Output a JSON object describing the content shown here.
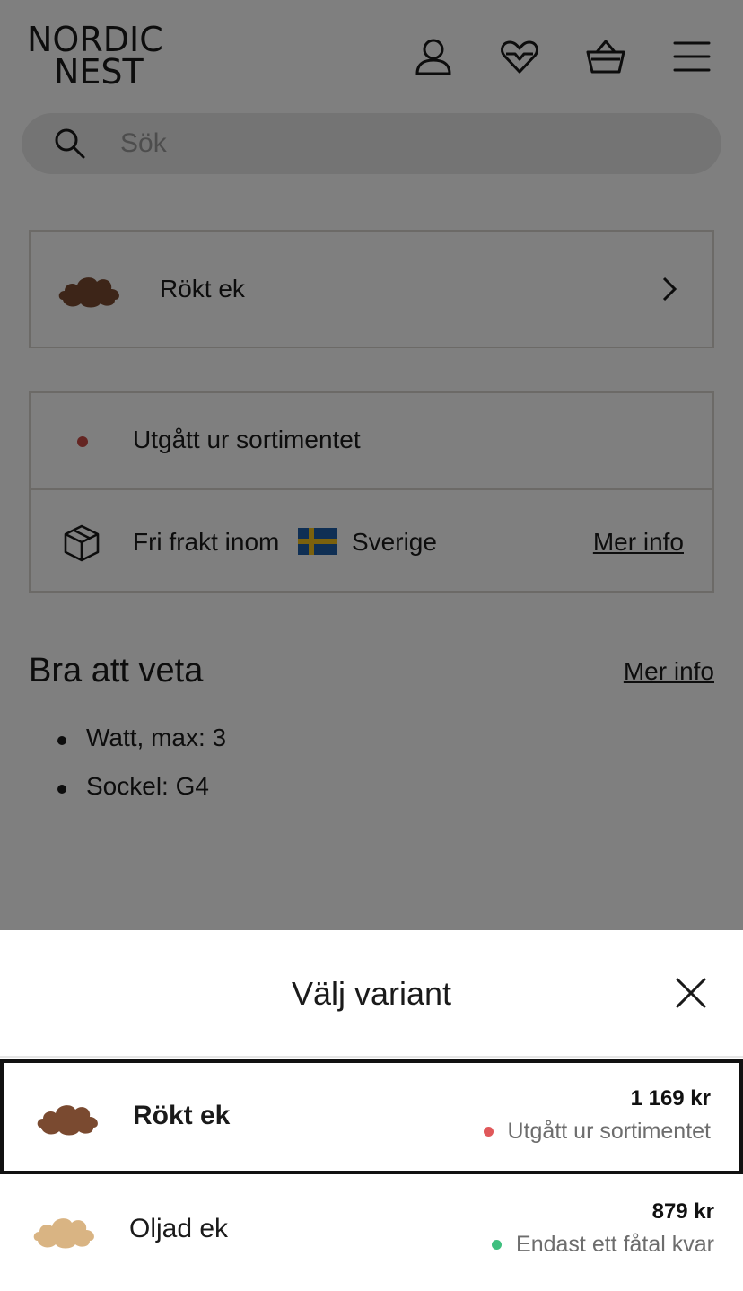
{
  "header": {
    "logo_line1": "NORDIC",
    "logo_line2": "NEST",
    "icons": [
      "account-icon",
      "heart-icon",
      "basket-icon",
      "menu-icon"
    ]
  },
  "search": {
    "placeholder": "Sök"
  },
  "selected_variant": {
    "label": "Rökt ek"
  },
  "availability": {
    "status": "Utgått ur sortimentet",
    "status_color": "#c94a45"
  },
  "shipping": {
    "text": "Fri frakt inom",
    "country": "Sverige",
    "more_link": "Mer info"
  },
  "good_to_know": {
    "title": "Bra att veta",
    "more_link": "Mer info",
    "items": [
      "Watt, max: 3",
      "Sockel: G4"
    ]
  },
  "sheet": {
    "title": "Välj variant",
    "options": [
      {
        "name": "Rökt ek",
        "price": "1 169 kr",
        "status": "Utgått ur sortimentet",
        "status_color": "#e0585a",
        "wood_color": "#7a4a30",
        "selected": true
      },
      {
        "name": "Oljad ek",
        "price": "879 kr",
        "status": "Endast ett fåtal kvar",
        "status_color": "#3fbf7f",
        "wood_color": "#d9b483",
        "selected": false
      }
    ]
  }
}
